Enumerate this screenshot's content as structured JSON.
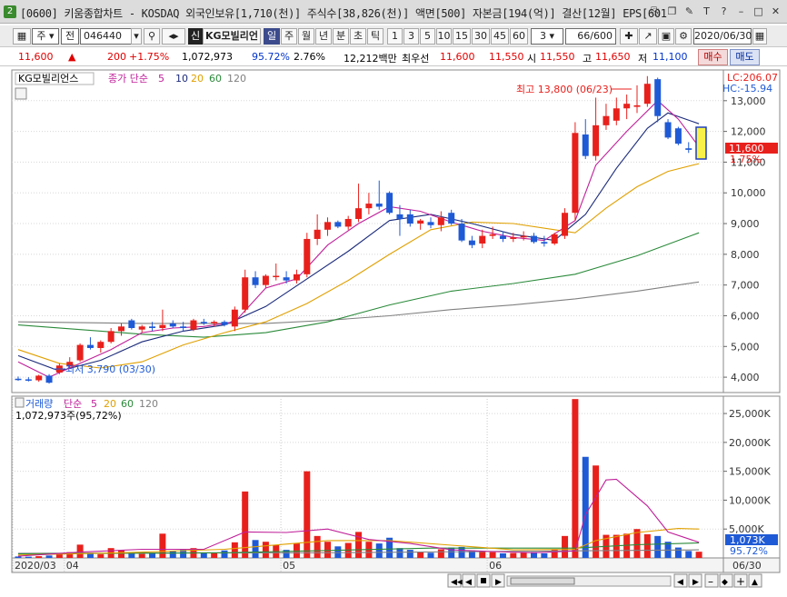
{
  "window": {
    "badge": "2",
    "title": "[0600] 키움종합차트 - KOSDAQ 외국인보유[1,710(천)] 주식수[38,826(천)] 액면[500] 자본금[194(억)] 결산[12월] EPS[601"
  },
  "toolbar": {
    "market_type": "주",
    "order_type": "전",
    "code": "046440",
    "sin_badge": "신",
    "stock_name": "KG모빌리언",
    "periods": [
      "일",
      "주",
      "월",
      "년",
      "분",
      "초",
      "틱"
    ],
    "active_period": "일",
    "intervals": [
      "1",
      "3",
      "5",
      "10",
      "15",
      "30",
      "45",
      "60"
    ],
    "interval_select": "3",
    "count": "66/600",
    "date": "2020/06/30"
  },
  "info": {
    "price": "11,600",
    "arrow": "▲",
    "change": "200",
    "change_pct": "+1.75%",
    "volume": "1,072,973",
    "vol_ratio": "95.72%",
    "turnover": "2.76%",
    "amount": "12,212백만",
    "best_bid_label": "최우선",
    "bid": "11,600",
    "ask": "11,550",
    "open_label": "시",
    "open": "11,550",
    "high_label": "고",
    "high": "11,650",
    "low_label": "저",
    "low": "11,100",
    "buy_label": "매수",
    "sell_label": "매도"
  },
  "price_panel": {
    "stock_label": "KG모빌리언스",
    "ma_title": "종가 단순",
    "ma_periods": [
      "5",
      "10",
      "20",
      "60",
      "120"
    ],
    "lc_label": "LC:206.07",
    "hc_label": "HC:-15.94",
    "current_tag": "11,600",
    "current_pct": "1.75%",
    "high_annotation": "최고 13,800 (06/23)",
    "low_annotation": "최저 3,790 (03/30)",
    "y_ticks": [
      "13,000",
      "12,000",
      "11,000",
      "10,000",
      "9,000",
      "8,000",
      "7,000",
      "6,000",
      "5,000",
      "4,000"
    ]
  },
  "volume_panel": {
    "title": "거래량",
    "ma_title": "단순",
    "ma_periods": [
      "5",
      "20",
      "60",
      "120"
    ],
    "current_label": "1,072,973주(95,72%)",
    "current_tag": "1,073K",
    "current_pct": "95.72%",
    "y_ticks": [
      "25,000K",
      "20,000K",
      "15,000K",
      "10,000K",
      "5,000K"
    ]
  },
  "x_axis": {
    "labels": [
      "2020/03",
      "04",
      "05",
      "06"
    ],
    "end_label": "06/30"
  },
  "colors": {
    "up": "#e8201c",
    "down": "#1f5ad6",
    "ma5": "#c0209a",
    "ma10": "#1a2a7a",
    "ma20": "#e0a000",
    "ma60": "#2a8a3a",
    "ma120": "#808080"
  },
  "chart_data": {
    "type": "candlestick",
    "x_range": [
      "2020/03/25",
      "2020/06/30"
    ],
    "ylim": [
      3500,
      14000
    ],
    "volume_ylim": [
      0,
      28000
    ],
    "volume_unit": "K",
    "candles": [
      {
        "o": 3950,
        "h": 4020,
        "l": 3880,
        "c": 3930,
        "v": 250
      },
      {
        "o": 3930,
        "h": 4000,
        "l": 3860,
        "c": 3900,
        "v": 220
      },
      {
        "o": 3900,
        "h": 4080,
        "l": 3850,
        "c": 4050,
        "v": 300
      },
      {
        "o": 4050,
        "h": 4100,
        "l": 3790,
        "c": 3820,
        "v": 420
      },
      {
        "o": 4150,
        "h": 4450,
        "l": 4100,
        "c": 4380,
        "v": 700
      },
      {
        "o": 4350,
        "h": 4650,
        "l": 4300,
        "c": 4500,
        "v": 1000
      },
      {
        "o": 4550,
        "h": 5100,
        "l": 4500,
        "c": 5050,
        "v": 2300
      },
      {
        "o": 5050,
        "h": 5300,
        "l": 4900,
        "c": 4950,
        "v": 900
      },
      {
        "o": 4950,
        "h": 5200,
        "l": 4800,
        "c": 5150,
        "v": 650
      },
      {
        "o": 5150,
        "h": 5600,
        "l": 5100,
        "c": 5500,
        "v": 1700
      },
      {
        "o": 5500,
        "h": 5750,
        "l": 5350,
        "c": 5650,
        "v": 1300
      },
      {
        "o": 5850,
        "h": 5900,
        "l": 5550,
        "c": 5600,
        "v": 900
      },
      {
        "o": 5550,
        "h": 5700,
        "l": 5450,
        "c": 5650,
        "v": 700
      },
      {
        "o": 5650,
        "h": 5800,
        "l": 5500,
        "c": 5600,
        "v": 800
      },
      {
        "o": 5600,
        "h": 6200,
        "l": 5500,
        "c": 5700,
        "v": 4200
      },
      {
        "o": 5750,
        "h": 5850,
        "l": 5600,
        "c": 5650,
        "v": 1200
      },
      {
        "o": 5650,
        "h": 5800,
        "l": 5500,
        "c": 5600,
        "v": 1400
      },
      {
        "o": 5550,
        "h": 5900,
        "l": 5500,
        "c": 5850,
        "v": 1700
      },
      {
        "o": 5800,
        "h": 5900,
        "l": 5700,
        "c": 5750,
        "v": 900
      },
      {
        "o": 5750,
        "h": 5850,
        "l": 5650,
        "c": 5800,
        "v": 900
      },
      {
        "o": 5800,
        "h": 5850,
        "l": 5650,
        "c": 5700,
        "v": 1300
      },
      {
        "o": 5650,
        "h": 6300,
        "l": 5500,
        "c": 6200,
        "v": 2700
      },
      {
        "o": 6200,
        "h": 7500,
        "l": 6100,
        "c": 7250,
        "v": 11500
      },
      {
        "o": 7250,
        "h": 7450,
        "l": 6900,
        "c": 7000,
        "v": 3100
      },
      {
        "o": 7000,
        "h": 7350,
        "l": 6900,
        "c": 7300,
        "v": 2800
      },
      {
        "o": 7300,
        "h": 7700,
        "l": 7150,
        "c": 7300,
        "v": 2200
      },
      {
        "o": 7250,
        "h": 7450,
        "l": 7050,
        "c": 7150,
        "v": 1400
      },
      {
        "o": 7150,
        "h": 7500,
        "l": 7050,
        "c": 7350,
        "v": 2500
      },
      {
        "o": 7350,
        "h": 8700,
        "l": 7250,
        "c": 8500,
        "v": 15000
      },
      {
        "o": 8500,
        "h": 9300,
        "l": 8300,
        "c": 8800,
        "v": 3800
      },
      {
        "o": 8800,
        "h": 9200,
        "l": 8600,
        "c": 9050,
        "v": 2800
      },
      {
        "o": 9050,
        "h": 9100,
        "l": 8850,
        "c": 8900,
        "v": 2000
      },
      {
        "o": 8900,
        "h": 9250,
        "l": 8800,
        "c": 9150,
        "v": 2600
      },
      {
        "o": 9150,
        "h": 10300,
        "l": 9050,
        "c": 9500,
        "v": 4500
      },
      {
        "o": 9500,
        "h": 10000,
        "l": 9300,
        "c": 9650,
        "v": 2800
      },
      {
        "o": 9650,
        "h": 10400,
        "l": 9450,
        "c": 9550,
        "v": 2500
      },
      {
        "o": 10000,
        "h": 10050,
        "l": 9300,
        "c": 9350,
        "v": 3500
      },
      {
        "o": 9300,
        "h": 9600,
        "l": 8600,
        "c": 9150,
        "v": 1700
      },
      {
        "o": 9300,
        "h": 9450,
        "l": 8900,
        "c": 9000,
        "v": 1400
      },
      {
        "o": 9000,
        "h": 9150,
        "l": 8800,
        "c": 9100,
        "v": 1100
      },
      {
        "o": 9050,
        "h": 9200,
        "l": 8850,
        "c": 8950,
        "v": 900
      },
      {
        "o": 8950,
        "h": 9400,
        "l": 8750,
        "c": 9200,
        "v": 1500
      },
      {
        "o": 9350,
        "h": 9450,
        "l": 8950,
        "c": 9000,
        "v": 1800
      },
      {
        "o": 9000,
        "h": 9150,
        "l": 8400,
        "c": 8450,
        "v": 1900
      },
      {
        "o": 8450,
        "h": 8600,
        "l": 8200,
        "c": 8300,
        "v": 1300
      },
      {
        "o": 8350,
        "h": 8800,
        "l": 8200,
        "c": 8600,
        "v": 1100
      },
      {
        "o": 8600,
        "h": 8900,
        "l": 8500,
        "c": 8650,
        "v": 1000
      },
      {
        "o": 8600,
        "h": 8750,
        "l": 8400,
        "c": 8500,
        "v": 800
      },
      {
        "o": 8500,
        "h": 8700,
        "l": 8400,
        "c": 8550,
        "v": 850
      },
      {
        "o": 8550,
        "h": 8750,
        "l": 8450,
        "c": 8600,
        "v": 900
      },
      {
        "o": 8600,
        "h": 8700,
        "l": 8350,
        "c": 8400,
        "v": 1000
      },
      {
        "o": 8400,
        "h": 8600,
        "l": 8250,
        "c": 8350,
        "v": 800
      },
      {
        "o": 8350,
        "h": 8700,
        "l": 8300,
        "c": 8650,
        "v": 1500
      },
      {
        "o": 8600,
        "h": 9500,
        "l": 8500,
        "c": 9350,
        "v": 3800
      },
      {
        "o": 9350,
        "h": 12300,
        "l": 9100,
        "c": 11950,
        "v": 27500
      },
      {
        "o": 11900,
        "h": 12400,
        "l": 11100,
        "c": 11200,
        "v": 17500
      },
      {
        "o": 11200,
        "h": 13100,
        "l": 11050,
        "c": 12200,
        "v": 16000
      },
      {
        "o": 12200,
        "h": 12900,
        "l": 12050,
        "c": 12500,
        "v": 4000
      },
      {
        "o": 12350,
        "h": 13100,
        "l": 12200,
        "c": 12750,
        "v": 4000
      },
      {
        "o": 12750,
        "h": 13200,
        "l": 12400,
        "c": 12900,
        "v": 4200
      },
      {
        "o": 12800,
        "h": 13500,
        "l": 12600,
        "c": 12850,
        "v": 5000
      },
      {
        "o": 12900,
        "h": 13800,
        "l": 12800,
        "c": 13550,
        "v": 4100
      },
      {
        "o": 13700,
        "h": 13750,
        "l": 12300,
        "c": 12500,
        "v": 3800
      },
      {
        "o": 12300,
        "h": 12400,
        "l": 11750,
        "c": 11800,
        "v": 2800
      },
      {
        "o": 12100,
        "h": 12150,
        "l": 11550,
        "c": 11600,
        "v": 1800
      },
      {
        "o": 11450,
        "h": 11650,
        "l": 11300,
        "c": 11400,
        "v": 1200
      },
      {
        "o": 11550,
        "h": 11650,
        "l": 11100,
        "c": 11600,
        "v": 1073
      }
    ],
    "ma_price": {
      "ma5": [
        [
          0,
          4500
        ],
        [
          3,
          4000
        ],
        [
          6,
          4450
        ],
        [
          9,
          4900
        ],
        [
          12,
          5450
        ],
        [
          15,
          5600
        ],
        [
          18,
          5650
        ],
        [
          21,
          5800
        ],
        [
          24,
          6900
        ],
        [
          27,
          7200
        ],
        [
          30,
          8300
        ],
        [
          33,
          9000
        ],
        [
          36,
          9550
        ],
        [
          39,
          9400
        ],
        [
          42,
          9050
        ],
        [
          45,
          8750
        ],
        [
          48,
          8550
        ],
        [
          51,
          8450
        ],
        [
          54,
          9100
        ],
        [
          56,
          10900
        ],
        [
          59,
          12000
        ],
        [
          62,
          13000
        ],
        [
          64,
          12400
        ],
        [
          66,
          11500
        ]
      ],
      "ma10": [
        [
          0,
          4700
        ],
        [
          4,
          4200
        ],
        [
          8,
          4550
        ],
        [
          12,
          5150
        ],
        [
          16,
          5500
        ],
        [
          20,
          5700
        ],
        [
          24,
          6300
        ],
        [
          28,
          7200
        ],
        [
          32,
          8100
        ],
        [
          36,
          9100
        ],
        [
          40,
          9300
        ],
        [
          44,
          9000
        ],
        [
          48,
          8650
        ],
        [
          52,
          8450
        ],
        [
          55,
          9300
        ],
        [
          58,
          10800
        ],
        [
          61,
          12100
        ],
        [
          63,
          12600
        ],
        [
          66,
          12250
        ]
      ],
      "ma20": [
        [
          0,
          4900
        ],
        [
          4,
          4450
        ],
        [
          8,
          4300
        ],
        [
          12,
          4500
        ],
        [
          16,
          5050
        ],
        [
          20,
          5450
        ],
        [
          24,
          5800
        ],
        [
          28,
          6400
        ],
        [
          32,
          7150
        ],
        [
          36,
          8000
        ],
        [
          40,
          8800
        ],
        [
          44,
          9050
        ],
        [
          48,
          9000
        ],
        [
          52,
          8800
        ],
        [
          54,
          8700
        ],
        [
          57,
          9500
        ],
        [
          60,
          10200
        ],
        [
          63,
          10700
        ],
        [
          66,
          10950
        ]
      ],
      "ma60": [
        [
          0,
          5700
        ],
        [
          6,
          5550
        ],
        [
          12,
          5400
        ],
        [
          18,
          5300
        ],
        [
          24,
          5450
        ],
        [
          30,
          5800
        ],
        [
          36,
          6350
        ],
        [
          42,
          6800
        ],
        [
          48,
          7050
        ],
        [
          54,
          7350
        ],
        [
          60,
          7950
        ],
        [
          66,
          8700
        ]
      ],
      "ma120": [
        [
          0,
          5800
        ],
        [
          12,
          5750
        ],
        [
          24,
          5750
        ],
        [
          30,
          5850
        ],
        [
          36,
          6000
        ],
        [
          42,
          6200
        ],
        [
          48,
          6350
        ],
        [
          54,
          6550
        ],
        [
          60,
          6800
        ],
        [
          66,
          7100
        ]
      ]
    },
    "ma_volume": {
      "ma5": [
        [
          0,
          300
        ],
        [
          6,
          1000
        ],
        [
          12,
          1500
        ],
        [
          18,
          1500
        ],
        [
          22,
          4500
        ],
        [
          26,
          4400
        ],
        [
          30,
          5000
        ],
        [
          34,
          3200
        ],
        [
          38,
          2500
        ],
        [
          42,
          1400
        ],
        [
          46,
          1100
        ],
        [
          50,
          900
        ],
        [
          54,
          1200
        ],
        [
          55,
          7500
        ],
        [
          57,
          13500
        ],
        [
          58,
          13600
        ],
        [
          61,
          9000
        ],
        [
          63,
          4500
        ],
        [
          66,
          2700
        ]
      ],
      "ma20": [
        [
          0,
          500
        ],
        [
          10,
          900
        ],
        [
          20,
          1500
        ],
        [
          30,
          3000
        ],
        [
          36,
          3000
        ],
        [
          42,
          2200
        ],
        [
          48,
          1400
        ],
        [
          54,
          1500
        ],
        [
          56,
          3000
        ],
        [
          60,
          4400
        ],
        [
          64,
          5100
        ],
        [
          66,
          5000
        ]
      ],
      "ma60": [
        [
          0,
          700
        ],
        [
          20,
          900
        ],
        [
          40,
          1700
        ],
        [
          54,
          1700
        ],
        [
          60,
          2300
        ],
        [
          66,
          2600
        ]
      ],
      "ma120": [
        [
          0,
          800
        ],
        [
          30,
          900
        ],
        [
          66,
          1400
        ]
      ]
    },
    "x_tick_index": {
      "2020/03": 0,
      "04": 5,
      "05": 26,
      "06": 46
    }
  }
}
